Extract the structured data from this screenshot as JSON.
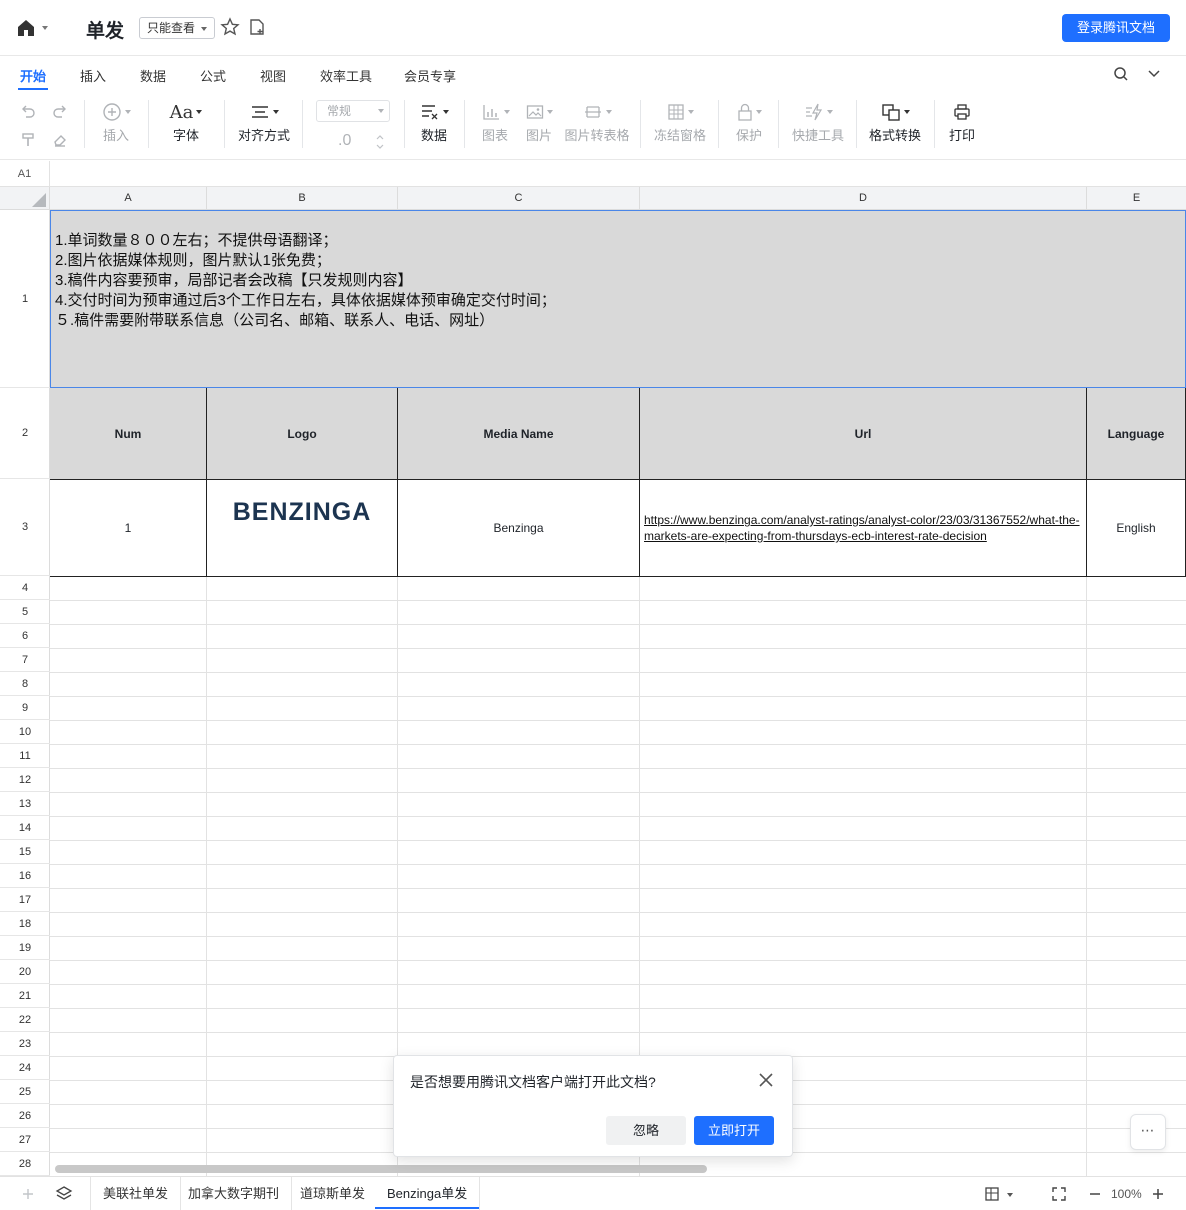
{
  "titlebar": {
    "title": "单发",
    "mode_label": "只能查看",
    "login_label": "登录腾讯文档"
  },
  "menu": {
    "tabs": [
      "开始",
      "插入",
      "数据",
      "公式",
      "视图",
      "效率工具",
      "会员专享"
    ],
    "active": 0
  },
  "toolbar": {
    "insert": "插入",
    "font": "字体",
    "align": "对齐方式",
    "number_format": "常规",
    "decimal": ".0",
    "data": "数据",
    "chart": "图表",
    "image": "图片",
    "image_to_table": "图片转表格",
    "freeze": "冻结窗格",
    "protect": "保护",
    "quick_tools": "快捷工具",
    "format_convert": "格式转换",
    "print": "打印"
  },
  "formula_bar": {
    "cell_ref": "A1"
  },
  "grid": {
    "columns": [
      "A",
      "B",
      "C",
      "D",
      "E"
    ],
    "rows": [
      "1",
      "2",
      "3",
      "4",
      "5",
      "6",
      "7",
      "8",
      "9",
      "10",
      "11",
      "12",
      "13",
      "14",
      "15",
      "16",
      "17",
      "18",
      "19",
      "20",
      "21",
      "22",
      "23",
      "24",
      "25",
      "26",
      "27",
      "28"
    ],
    "notes": [
      "1.单词数量８００左右；不提供母语翻译；",
      "2.图片依据媒体规则，图片默认1张免费；",
      "3.稿件内容要预审，局部记者会改稿【只发规则内容】",
      "4.交付时间为预审通过后3个工作日左右，具体依据媒体预审确定交付时间；",
      "５.稿件需要附带联系信息（公司名、邮箱、联系人、电话、网址）"
    ],
    "header": {
      "num": "Num",
      "logo": "Logo",
      "media_name": "Media Name",
      "url": "Url",
      "language": "Language"
    },
    "row": {
      "num": "1",
      "logo_text": "BENZINGA",
      "media_name": "Benzinga",
      "url": "https://www.benzinga.com/analyst-ratings/analyst-color/23/03/31367552/what-the-markets-are-expecting-from-thursdays-ecb-interest-rate-decision",
      "language": "English"
    }
  },
  "dialog": {
    "question": "是否想要用腾讯文档客户端打开此文档?",
    "ignore": "忽略",
    "open": "立即打开"
  },
  "sheets": [
    "美联社单发",
    "加拿大数字期刊",
    "道琼斯单发",
    "Benzinga单发"
  ],
  "active_sheet": 3,
  "zoom": "100%",
  "colors": {
    "accent": "#1e6fff",
    "selection": "#4a86e8",
    "header_fill": "#d9d9d9"
  }
}
